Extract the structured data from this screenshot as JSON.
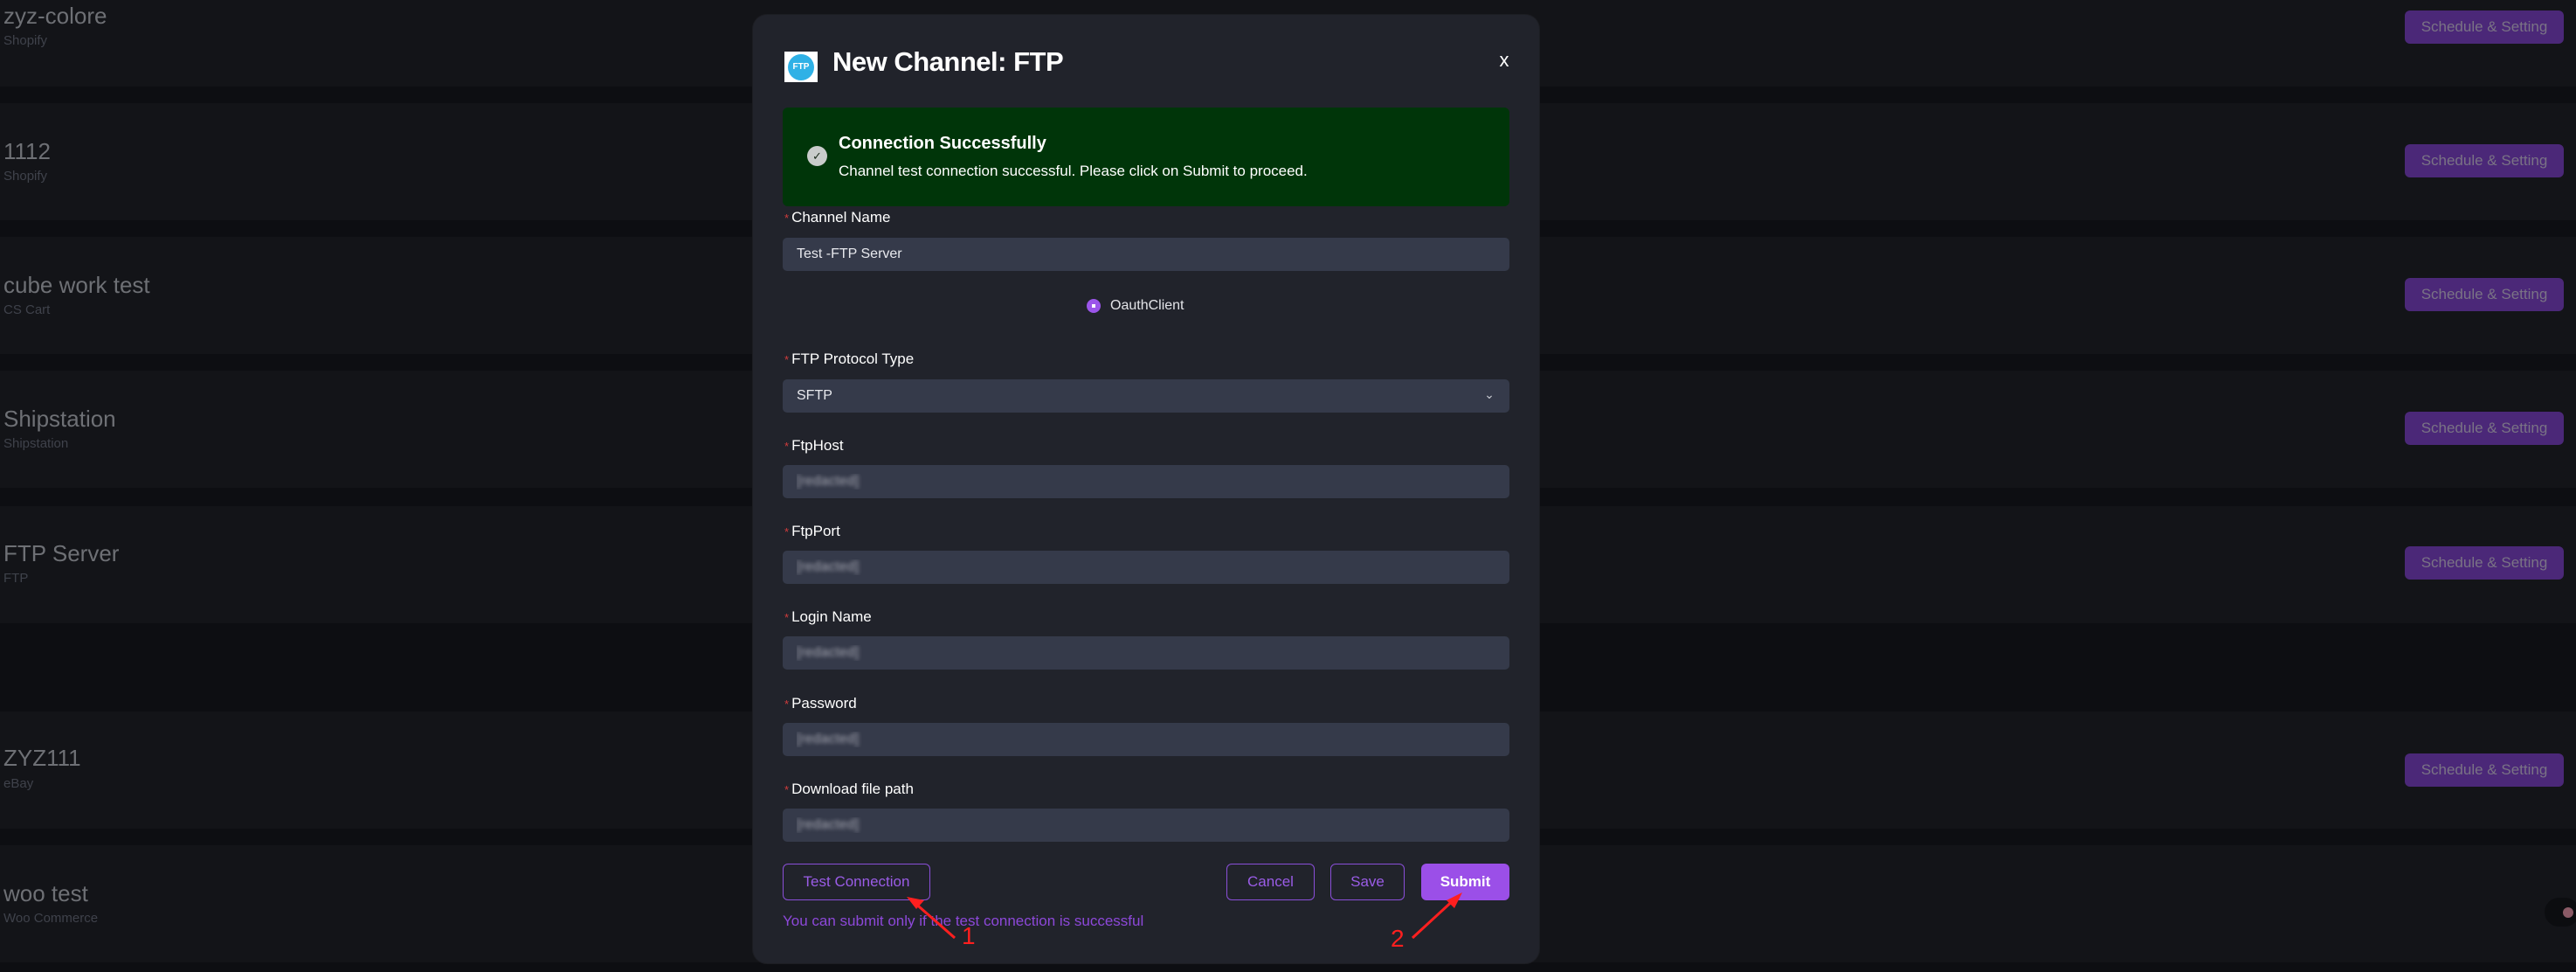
{
  "channel_list": [
    {
      "name": "zyz-colore",
      "platform": "Shopify",
      "action_label": "Schedule & Setting"
    },
    {
      "name": "1112",
      "platform": "Shopify",
      "action_label": "Schedule & Setting"
    },
    {
      "name": "cube work test",
      "platform": "CS Cart",
      "action_label": "Schedule & Setting"
    },
    {
      "name": "Shipstation",
      "platform": "Shipstation",
      "action_label": "Schedule & Setting"
    },
    {
      "name": "FTP Server",
      "platform": "FTP",
      "action_label": "Schedule & Setting"
    },
    {
      "name": "ZYZ111",
      "platform": "eBay",
      "action_label": "Schedule & Setting"
    },
    {
      "name": "woo test",
      "platform": "Woo Commerce",
      "action_label": ""
    }
  ],
  "modal": {
    "logo_text": "FTP",
    "title": "New Channel: FTP",
    "close_label": "x",
    "alert": {
      "title": "Connection Successfully",
      "message": "Channel test connection successful. Please click on Submit to proceed.",
      "icon": "check-circle-icon",
      "color": "#003509"
    },
    "fields": {
      "channel_name": {
        "label": "Channel Name",
        "value": "Test -FTP Server",
        "required": true
      },
      "auth_option": {
        "label": "OauthClient",
        "selected": true
      },
      "protocol": {
        "label": "FTP Protocol Type",
        "value": "SFTP",
        "required": true
      },
      "host": {
        "label": "FtpHost",
        "value": "[redacted]",
        "required": true
      },
      "port": {
        "label": "FtpPort",
        "value": "[redacted]",
        "required": true
      },
      "login": {
        "label": "Login Name",
        "value": "[redacted]",
        "required": true
      },
      "password": {
        "label": "Password",
        "value": "[redacted]",
        "required": true
      },
      "download_path": {
        "label": "Download file path",
        "value": "[redacted]",
        "required": true
      }
    },
    "required_marker": "*",
    "buttons": {
      "test_connection": "Test Connection",
      "cancel": "Cancel",
      "save": "Save",
      "submit": "Submit"
    },
    "hint": "You can submit only if the test connection is successful"
  },
  "annotations": [
    {
      "label": "1",
      "target": "test-connection-button"
    },
    {
      "label": "2",
      "target": "submit-button"
    }
  ],
  "colors": {
    "accent": "#9b4fe8",
    "row_button": "#4b2878",
    "background": "#0d0e12",
    "annotation": "#ff1f1f"
  }
}
